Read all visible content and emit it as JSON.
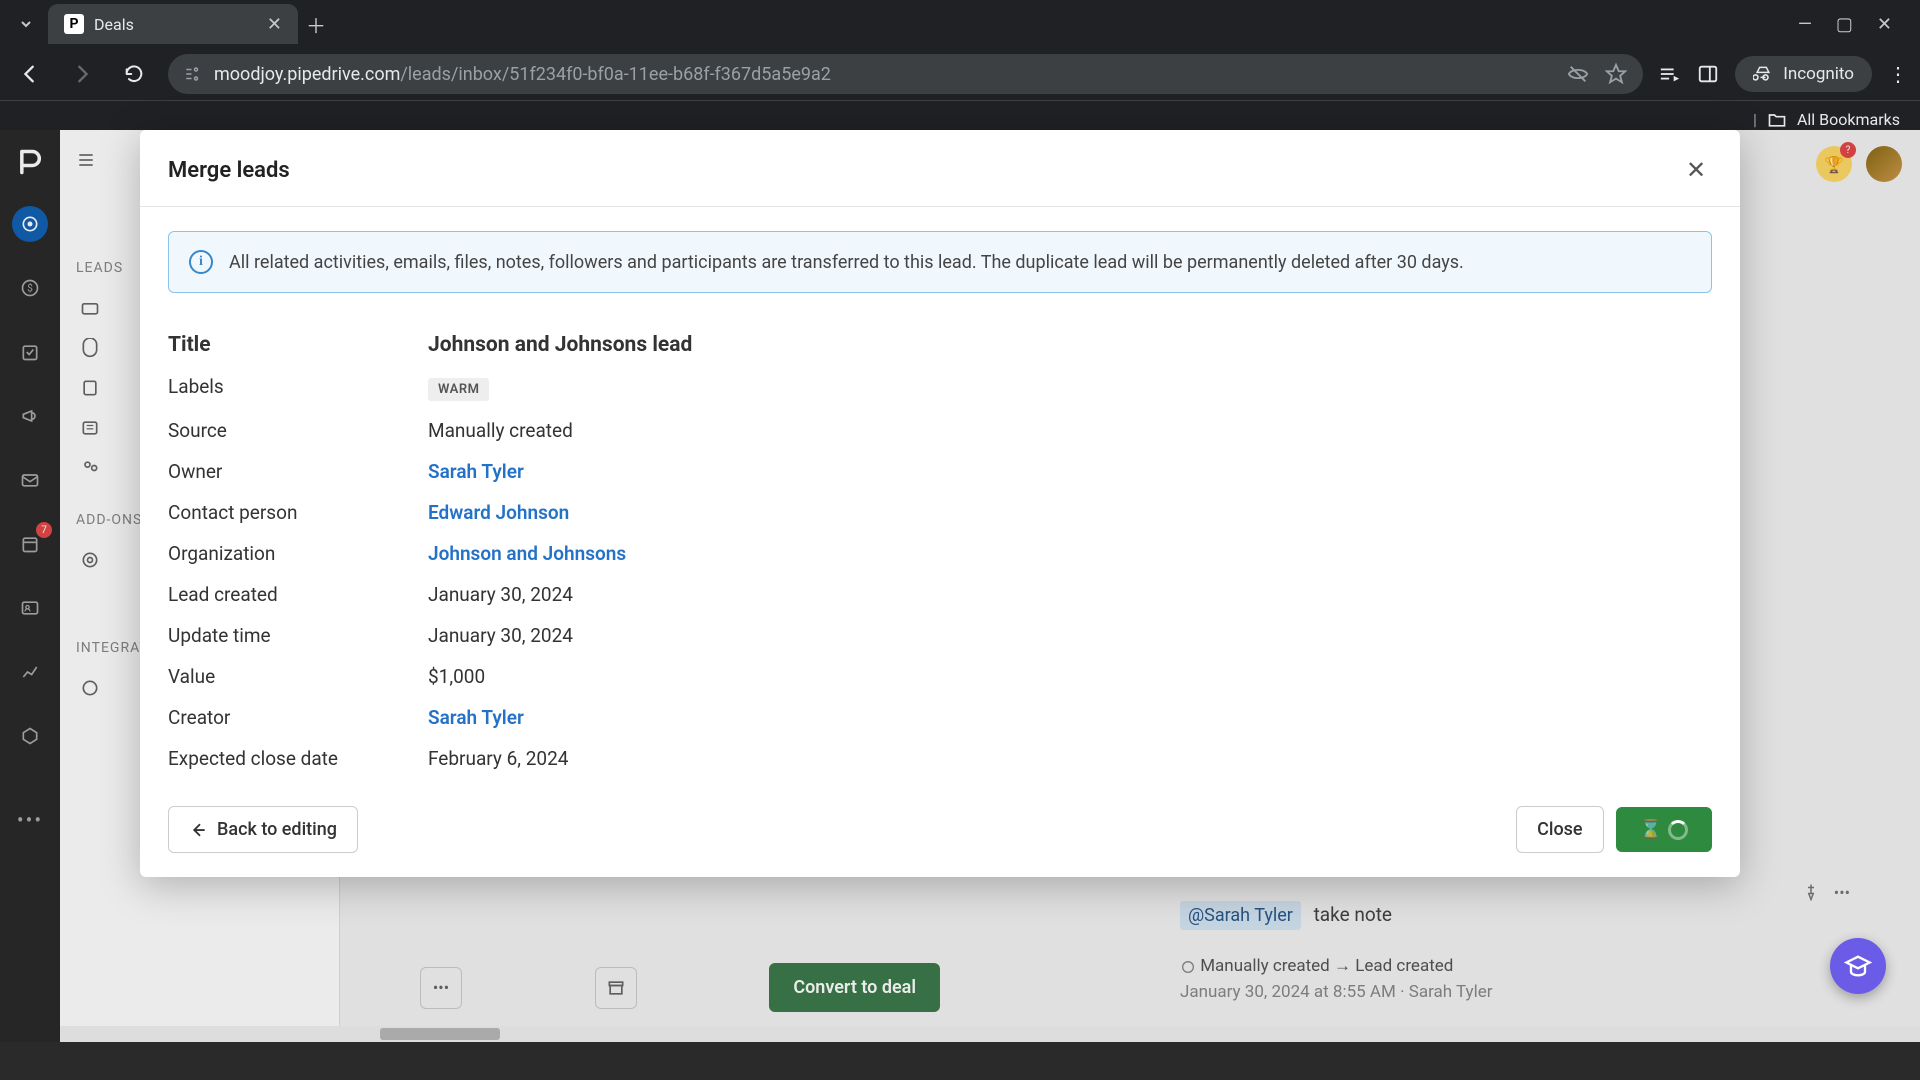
{
  "browser": {
    "tab_title": "Deals",
    "tab_favicon": "P",
    "url_domain": "moodjoy.pipedrive.com",
    "url_path": "/leads/inbox/51f234f0-bf0a-11ee-b68f-f367d5a5e9a2",
    "incognito_label": "Incognito",
    "bookmarks_label": "All Bookmarks"
  },
  "sidebar": {
    "sections": {
      "leads": "LEADS",
      "addons": "ADD-ONS",
      "integrations": "INTEGRATIONS"
    },
    "badge_count": "7"
  },
  "modal": {
    "title": "Merge leads",
    "info_text": "All related activities, emails, files, notes, followers and participants are transferred to this lead. The duplicate lead will be permanently deleted after 30 days.",
    "fields": {
      "title": {
        "label": "Title",
        "value": "Johnson and Johnsons lead"
      },
      "labels": {
        "label": "Labels",
        "value": "WARM"
      },
      "source": {
        "label": "Source",
        "value": "Manually created"
      },
      "owner": {
        "label": "Owner",
        "value": "Sarah Tyler"
      },
      "contact": {
        "label": "Contact person",
        "value": "Edward Johnson"
      },
      "org": {
        "label": "Organization",
        "value": "Johnson and Johnsons"
      },
      "created": {
        "label": "Lead created",
        "value": "January 30, 2024"
      },
      "updated": {
        "label": "Update time",
        "value": "January 30, 2024"
      },
      "value": {
        "label": "Value",
        "value": "$1,000"
      },
      "creator": {
        "label": "Creator",
        "value": "Sarah Tyler"
      },
      "expected": {
        "label": "Expected close date",
        "value": "February 6, 2024"
      }
    },
    "buttons": {
      "back": "Back to editing",
      "close": "Close"
    }
  },
  "background": {
    "mention": "@Sarah Tyler",
    "mention_text": "take note",
    "activity_line": "Manually created → Lead created",
    "activity_meta": "January 30, 2024 at 8:55 AM · Sarah Tyler",
    "convert_label": "Convert to deal"
  }
}
